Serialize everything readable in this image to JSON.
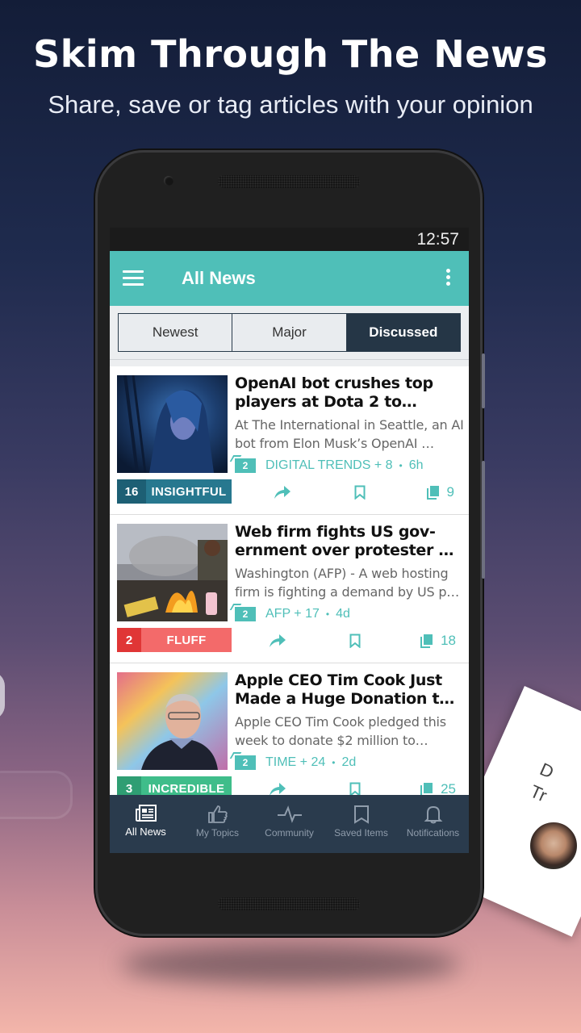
{
  "hero": {
    "title": "Skim Through The News",
    "subtitle": "Share, save or tag articles with your opinion"
  },
  "status_bar": {
    "time": "12:57"
  },
  "app_bar": {
    "title": "All News",
    "menu_icon": "hamburger-icon",
    "more_icon": "more-vertical-icon"
  },
  "segments": {
    "items": [
      {
        "label": "Newest",
        "active": false
      },
      {
        "label": "Major",
        "active": false
      },
      {
        "label": "Discussed",
        "active": true
      }
    ]
  },
  "articles": [
    {
      "headline": "OpenAI bot crushes top players at Dota 2 to…",
      "summary": "At The International in Seattle, an AI bot from Elon Musk’s OpenAI …",
      "tag_count": "2",
      "source": "DIGITAL TRENDS + 8",
      "age": "6h",
      "rating_count": "16",
      "rating_label": "INSIGHTFUL",
      "rating_color_dark": "#1d5f74",
      "rating_color": "#27788f",
      "comments": "9",
      "image": "dota-character-image"
    },
    {
      "headline": "Web firm fights US gov-ernment over protester …",
      "summary": "Washington (AFP) - A web hosting firm is fighting a demand by US p…",
      "tag_count": "2",
      "source": "AFP + 17",
      "age": "4d",
      "rating_count": "2",
      "rating_label": "FLUFF",
      "rating_color_dark": "#e03636",
      "rating_color": "#f36a6a",
      "comments": "18",
      "image": "protest-fire-image"
    },
    {
      "headline": "Apple CEO Tim Cook Just Made a Huge Donation t…",
      "summary": "Apple CEO Tim Cook pledged this week to donate $2 million to…",
      "tag_count": "2",
      "source": "TIME + 24",
      "age": "2d",
      "rating_count": "3",
      "rating_label": "INCREDIBLE",
      "rating_color_dark": "#2f9e73",
      "rating_color": "#3fbd8a",
      "comments": "25",
      "image": "tim-cook-image"
    }
  ],
  "bottom_nav": {
    "items": [
      {
        "label": "All News",
        "icon": "newspaper-icon",
        "active": true
      },
      {
        "label": "My Topics",
        "icon": "thumbs-up-icon",
        "active": false
      },
      {
        "label": "Community",
        "icon": "pulse-icon",
        "active": false
      },
      {
        "label": "Saved Items",
        "icon": "bookmark-icon",
        "active": false
      },
      {
        "label": "Notifications",
        "icon": "bell-icon",
        "active": false
      }
    ]
  },
  "colors": {
    "accent": "#4fbfb8",
    "nav_bg": "#2a3b4d",
    "segment_active": "#253646"
  },
  "decor": {
    "right_card_text": "D\nTr"
  }
}
